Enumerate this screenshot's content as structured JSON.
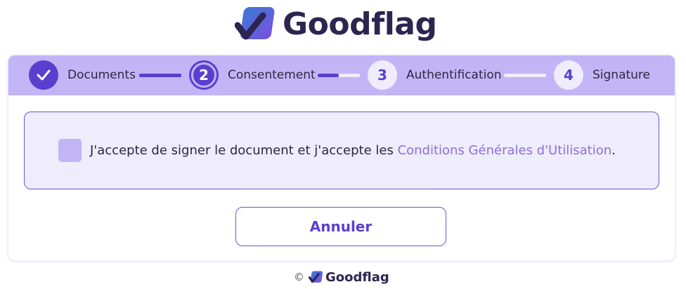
{
  "brand": {
    "name": "Goodflag"
  },
  "stepper": {
    "steps": [
      {
        "number": "1",
        "label": "Documents",
        "state": "done"
      },
      {
        "number": "2",
        "label": "Consentement",
        "state": "current"
      },
      {
        "number": "3",
        "label": "Authentification",
        "state": "todo"
      },
      {
        "number": "4",
        "label": "Signature",
        "state": "todo"
      }
    ],
    "progress": [
      1.0,
      0.5,
      0.0
    ]
  },
  "consent": {
    "text": "J'accepte de signer le document et j'accepte les ",
    "link": "Conditions Générales d'Utilisation",
    "suffix": ".",
    "checked": false
  },
  "actions": {
    "cancel_label": "Annuler"
  },
  "footer": {
    "copyright": "©",
    "brand": "Goodflag"
  },
  "colors": {
    "accent": "#5a3fcf",
    "stepper_bg": "#c2b5f6",
    "panel_bg": "#efecfb",
    "link": "#8a72d8"
  }
}
